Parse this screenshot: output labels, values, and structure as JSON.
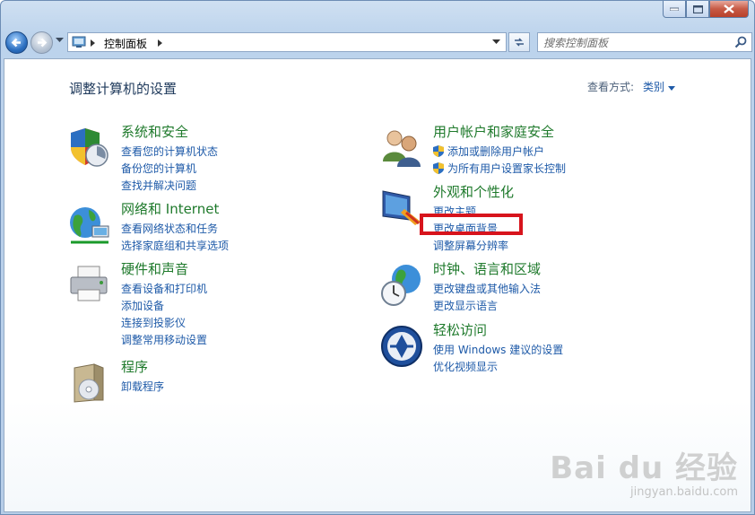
{
  "window": {
    "breadcrumb": "控制面板"
  },
  "search": {
    "placeholder": "搜索控制面板"
  },
  "header": {
    "title": "调整计算机的设置",
    "view_by_label": "查看方式:",
    "view_by_value": "类别"
  },
  "categories": [
    {
      "title": "系统和安全",
      "links": [
        "查看您的计算机状态",
        "备份您的计算机",
        "查找并解决问题"
      ]
    },
    {
      "title": "网络和 Internet",
      "links": [
        "查看网络状态和任务",
        "选择家庭组和共享选项"
      ]
    },
    {
      "title": "硬件和声音",
      "links": [
        "查看设备和打印机",
        "添加设备",
        "连接到投影仪",
        "调整常用移动设置"
      ]
    },
    {
      "title": "程序",
      "links": [
        "卸载程序"
      ]
    },
    {
      "title": "用户帐户和家庭安全",
      "links": [
        "添加或删除用户帐户",
        "为所有用户设置家长控制"
      ]
    },
    {
      "title": "外观和个性化",
      "links": [
        "更改主题",
        "更改桌面背景",
        "调整屏幕分辨率"
      ]
    },
    {
      "title": "时钟、语言和区域",
      "links": [
        "更改键盘或其他输入法",
        "更改显示语言"
      ]
    },
    {
      "title": "轻松访问",
      "links": [
        "使用 Windows 建议的设置",
        "优化视频显示"
      ]
    }
  ],
  "watermark": {
    "main": "Bai du 经验",
    "sub": "jingyan.baidu.com"
  },
  "colors": {
    "category_title": "#1f7a2c",
    "link": "#1e5aa8",
    "highlight": "#d7141c"
  }
}
